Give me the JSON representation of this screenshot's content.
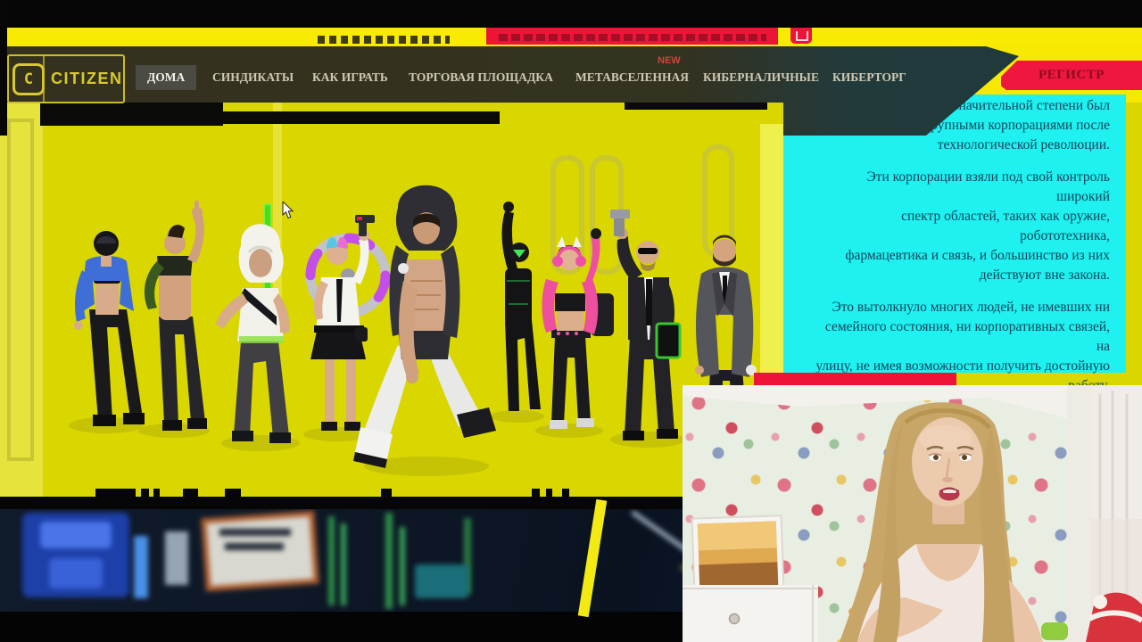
{
  "site": {
    "logo_text": "CITIZEN",
    "logo_mark": "C",
    "register_label": "РЕГИСТР",
    "nav": [
      {
        "label": "ДОМА",
        "active": true
      },
      {
        "label": "СИНДИКАТЫ"
      },
      {
        "label": "КАК ИГРАТЬ"
      },
      {
        "label": "ТОРГОВАЯ ПЛОЩАДКА"
      },
      {
        "label": "МЕТАВСЕЛЕННАЯ",
        "badge": "NEW"
      },
      {
        "label": "КИБЕРНАЛИЧНЫЕ"
      },
      {
        "label": "КИБЕРТОРГ"
      }
    ],
    "story": {
      "p1": [
        "который в значительной степени был",
        "крупными корпорациями после",
        "технологической революции."
      ],
      "p2": [
        "Эти корпорации взяли под свой контроль широкий",
        "спектр областей, таких как оружие, робототехника,",
        "фармацевтика и связь, и большинство из них",
        "действуют вне закона."
      ],
      "p3": [
        "Это вытолкнуло многих людей, не имевших ни",
        "семейного состояния, ни корпоративных связей, на",
        "улицу, не имея возможности получить достойную",
        "работу."
      ]
    },
    "carousel": {
      "dots": [
        "active",
        "inactive",
        "inactive",
        "inactive"
      ],
      "active_index": 0
    },
    "colors": {
      "accent_yellow": "#f6e800",
      "hero_yellow": "#d9d600",
      "accent_cyan": "#1ff0f0",
      "accent_red": "#ee1438",
      "header_dark": "#34321e",
      "story_text": "#16465c"
    }
  }
}
